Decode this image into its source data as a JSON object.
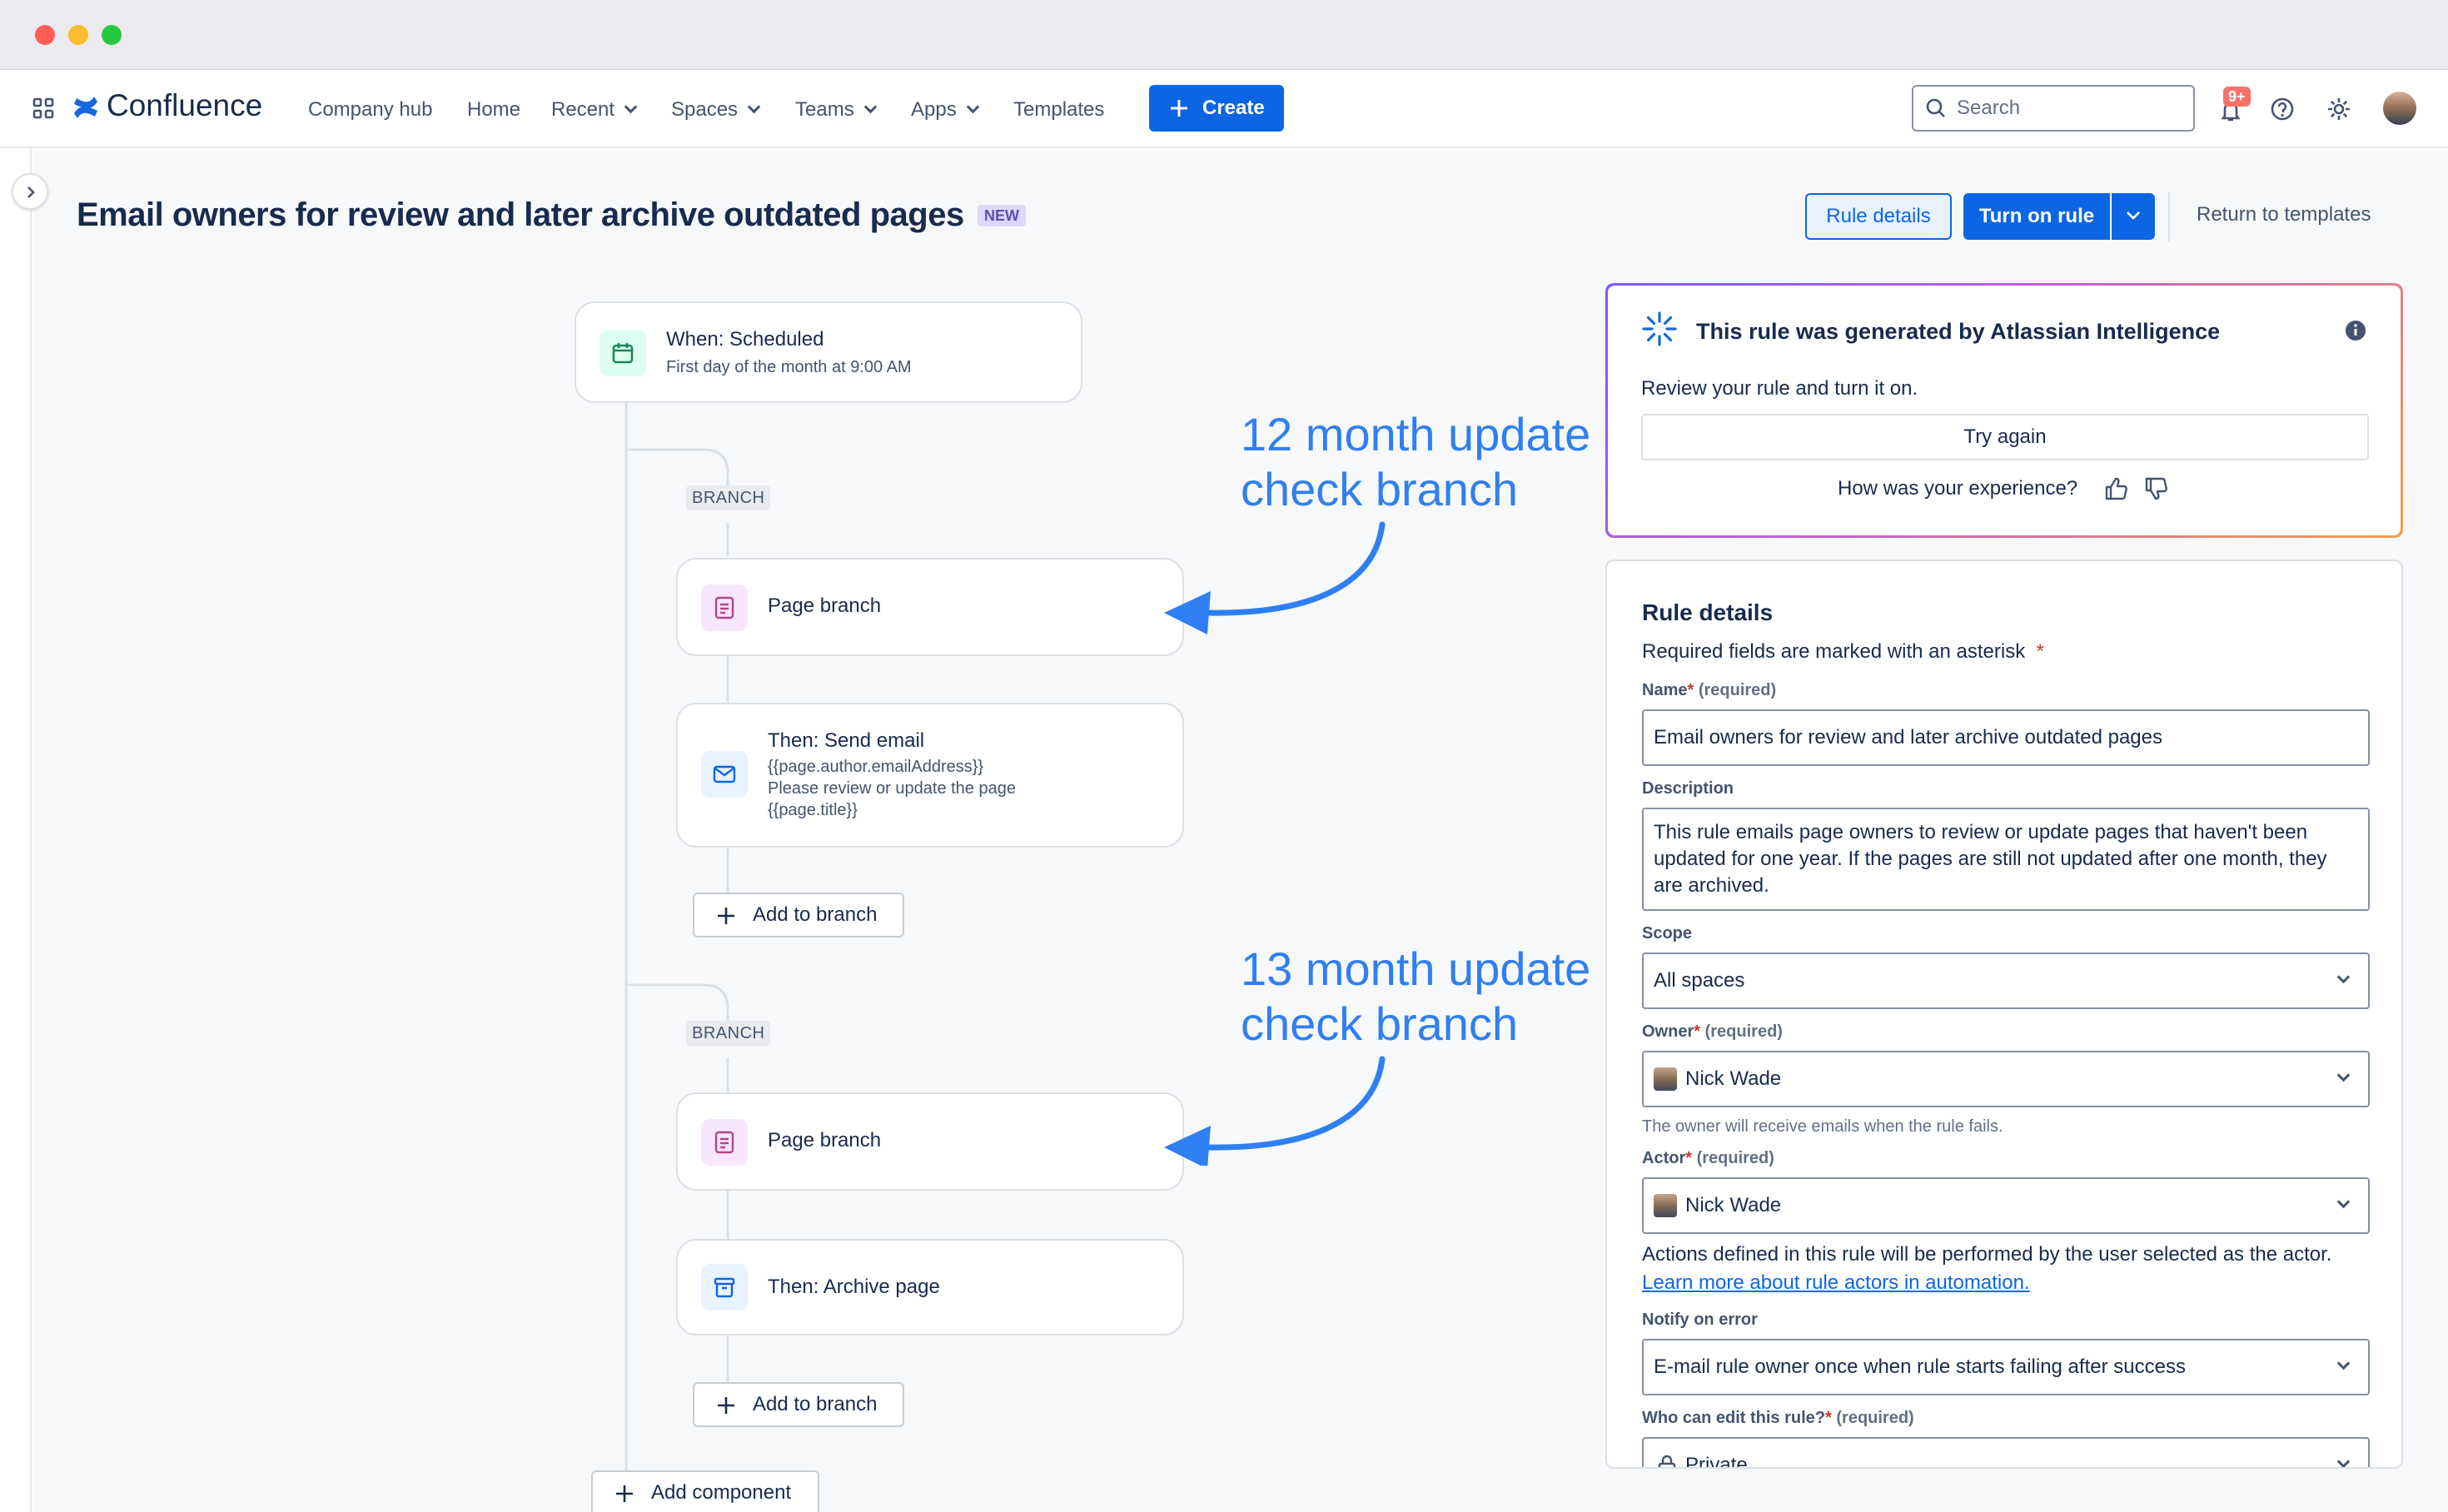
{
  "nav": {
    "brand": "Confluence",
    "items": [
      "Company hub",
      "Home",
      "Recent",
      "Spaces",
      "Teams",
      "Apps",
      "Templates"
    ],
    "create_label": "Create",
    "search_placeholder": "Search",
    "notification_count": "9+"
  },
  "header": {
    "title": "Email owners for review and later archive outdated pages",
    "badge": "NEW",
    "rule_details_button": "Rule details",
    "turn_on_button": "Turn on rule",
    "return_link": "Return to templates"
  },
  "flow": {
    "trigger": {
      "title": "When: Scheduled",
      "subtitle": "First day of the month at 9:00 AM"
    },
    "branch_label": "BRANCH",
    "branch1": {
      "condition": "Page branch",
      "action_title": "Then: Send email",
      "action_lines": [
        "{{page.author.emailAddress}}",
        "Please review or update the page",
        "{{page.title}}"
      ],
      "add_label": "Add to branch"
    },
    "branch2": {
      "condition": "Page branch",
      "action_title": "Then: Archive page",
      "add_label": "Add to branch"
    },
    "add_component": "Add component"
  },
  "annotations": [
    {
      "line1": "12 month update",
      "line2": "check branch"
    },
    {
      "line1": "13 month update",
      "line2": "check branch"
    }
  ],
  "ai_panel": {
    "title": "This rule was generated by Atlassian Intelligence",
    "text": "Review your rule and turn it on.",
    "try_again": "Try again",
    "experience": "How was your experience?"
  },
  "rule_details": {
    "heading": "Rule details",
    "required_note": "Required fields are marked with an asterisk",
    "required_tag": "(required)",
    "name_label": "Name",
    "name_value": "Email owners for review and later archive outdated pages",
    "description_label": "Description",
    "description_value": "This rule emails page owners to review or update pages that haven't been updated for one year. If the pages are still not updated after one month, they are archived.",
    "scope_label": "Scope",
    "scope_value": "All spaces",
    "owner_label": "Owner",
    "owner_value": "Nick Wade",
    "owner_help": "The owner will receive emails when the rule fails.",
    "actor_label": "Actor",
    "actor_value": "Nick Wade",
    "actor_help": "Actions defined in this rule will be performed by the user selected as the actor.",
    "actor_link": "Learn more about rule actors in automation.",
    "notify_label": "Notify on error",
    "notify_value": "E-mail rule owner once when rule starts failing after success",
    "edit_label": "Who can edit this rule?",
    "edit_value": "Private"
  }
}
